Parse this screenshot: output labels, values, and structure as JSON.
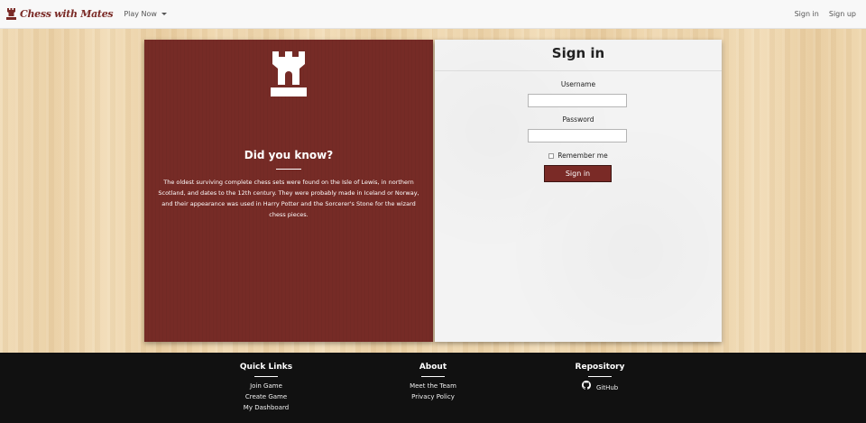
{
  "navbar": {
    "brand": "Chess with Mates",
    "play_now": "Play Now",
    "sign_in": "Sign in",
    "sign_up": "Sign up"
  },
  "info_panel": {
    "heading": "Did you know?",
    "fact": "The oldest surviving complete chess sets were found on the Isle of Lewis, in northern Scotland, and dates to the 12th century. They were probably made in Iceland or Norway, and their appearance was used in Harry Potter and the Sorcerer's Stone for the wizard chess pieces."
  },
  "signin_form": {
    "title": "Sign in",
    "username_label": "Username",
    "username_value": "",
    "password_label": "Password",
    "password_value": "",
    "remember_label": "Remember me",
    "remember_checked": false,
    "submit_label": "Sign in"
  },
  "footer": {
    "quick_links": {
      "heading": "Quick Links",
      "items": [
        "Join Game",
        "Create Game",
        "My Dashboard"
      ]
    },
    "about": {
      "heading": "About",
      "items": [
        "Meet the Team",
        "Privacy Policy"
      ]
    },
    "repository": {
      "heading": "Repository",
      "link": "GitHub"
    }
  },
  "colors": {
    "brand": "#7a2a26",
    "panel": "#762b26",
    "footer": "#111111",
    "wood": "#ecd5ae"
  },
  "icons": [
    "rook-icon",
    "chevron-down-icon",
    "github-icon",
    "brand-rook-icon"
  ]
}
